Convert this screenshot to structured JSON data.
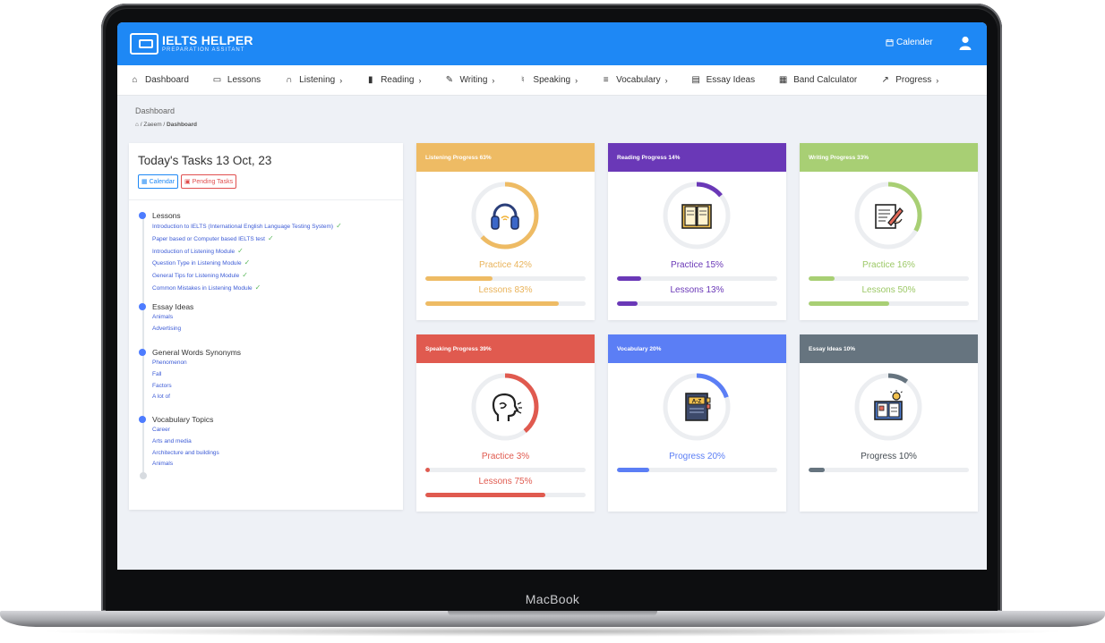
{
  "device": {
    "label": "MacBook"
  },
  "header": {
    "logo_title": "IELTS HELPER",
    "logo_subtitle": "PREPARATION ASSITANT",
    "calendar_link": "Calender",
    "accent": "#1e88f5"
  },
  "nav": [
    {
      "label": "Dashboard",
      "icon": "home-icon",
      "chevron": false
    },
    {
      "label": "Lessons",
      "icon": "board-icon",
      "chevron": false
    },
    {
      "label": "Listening",
      "icon": "headphones-icon",
      "chevron": true
    },
    {
      "label": "Reading",
      "icon": "book-icon",
      "chevron": true
    },
    {
      "label": "Writing",
      "icon": "edit-icon",
      "chevron": true
    },
    {
      "label": "Speaking",
      "icon": "microphone-icon",
      "chevron": true
    },
    {
      "label": "Vocabulary",
      "icon": "list-icon",
      "chevron": true
    },
    {
      "label": "Essay Ideas",
      "icon": "document-icon",
      "chevron": false
    },
    {
      "label": "Band Calculator",
      "icon": "calculator-icon",
      "chevron": false
    },
    {
      "label": "Progress",
      "icon": "trend-icon",
      "chevron": true
    }
  ],
  "breadcrumb": {
    "title": "Dashboard",
    "path_user": "Zaeem",
    "path_current": "Dashboard",
    "separator": "/"
  },
  "tasks": {
    "title": "Today's Tasks 13 Oct, 23",
    "calendar_button": "Calendar",
    "pending_button": "Pending Tasks",
    "groups": [
      {
        "title": "Lessons",
        "items": [
          {
            "text": "Introduction to IELTS (International English Language Testing System)",
            "done": true
          },
          {
            "text": "Paper based or Computer based IELTS test",
            "done": true
          },
          {
            "text": "Introduction of Listening Module",
            "done": true
          },
          {
            "text": "Question Type in Listening Module",
            "done": true
          },
          {
            "text": "General Tips for Listening Module",
            "done": true
          },
          {
            "text": "Common Mistakes in Listening Module",
            "done": true
          }
        ]
      },
      {
        "title": "Essay Ideas",
        "items": [
          {
            "text": "Animals",
            "done": false
          },
          {
            "text": "Advertising",
            "done": false
          }
        ]
      },
      {
        "title": "General Words Synonyms",
        "items": [
          {
            "text": "Phenomenon",
            "done": false
          },
          {
            "text": "Fall",
            "done": false
          },
          {
            "text": "Factors",
            "done": false
          },
          {
            "text": "A lot of",
            "done": false
          }
        ]
      },
      {
        "title": "Vocabulary Topics",
        "items": [
          {
            "text": "Career",
            "done": false
          },
          {
            "text": "Arts and media",
            "done": false
          },
          {
            "text": "Architecture and buildings",
            "done": false
          },
          {
            "text": "Animals",
            "done": false
          }
        ]
      }
    ]
  },
  "cards": [
    {
      "title": "Listening Progress 63%",
      "color": "#eebb64",
      "text_color": "#e9b35a",
      "ring": 0.63,
      "icon": "headphones-icon",
      "bars": [
        {
          "label": "Practice 42%",
          "value": 0.42
        },
        {
          "label": "Lessons 83%",
          "value": 0.83
        }
      ]
    },
    {
      "title": "Reading Progress 14%",
      "color": "#6a38b7",
      "text_color": "#6a38b7",
      "ring": 0.14,
      "icon": "book-icon",
      "bars": [
        {
          "label": "Practice 15%",
          "value": 0.15
        },
        {
          "label": "Lessons 13%",
          "value": 0.13
        }
      ]
    },
    {
      "title": "Writing Progress 33%",
      "color": "#a8cf74",
      "text_color": "#9cc866",
      "ring": 0.33,
      "icon": "writing-icon",
      "bars": [
        {
          "label": "Practice 16%",
          "value": 0.16
        },
        {
          "label": "Lessons 50%",
          "value": 0.5
        }
      ]
    },
    {
      "title": "Speaking Progress 39%",
      "color": "#e05a4f",
      "text_color": "#e05a4f",
      "ring": 0.39,
      "icon": "speaking-head-icon",
      "bars": [
        {
          "label": "Practice 3%",
          "value": 0.03
        },
        {
          "label": "Lessons 75%",
          "value": 0.75
        }
      ]
    },
    {
      "title": "Vocabulary 20%",
      "color": "#5b7ef5",
      "text_color": "#5b7ef5",
      "ring": 0.2,
      "icon": "dictionary-icon",
      "bars": [
        {
          "label": "Progress 20%",
          "value": 0.2
        }
      ]
    },
    {
      "title": "Essay Ideas 10%",
      "color": "#66747f",
      "text_color": "#444b52",
      "ring": 0.1,
      "icon": "idea-book-icon",
      "bars": [
        {
          "label": "Progress 10%",
          "value": 0.1
        }
      ]
    }
  ]
}
